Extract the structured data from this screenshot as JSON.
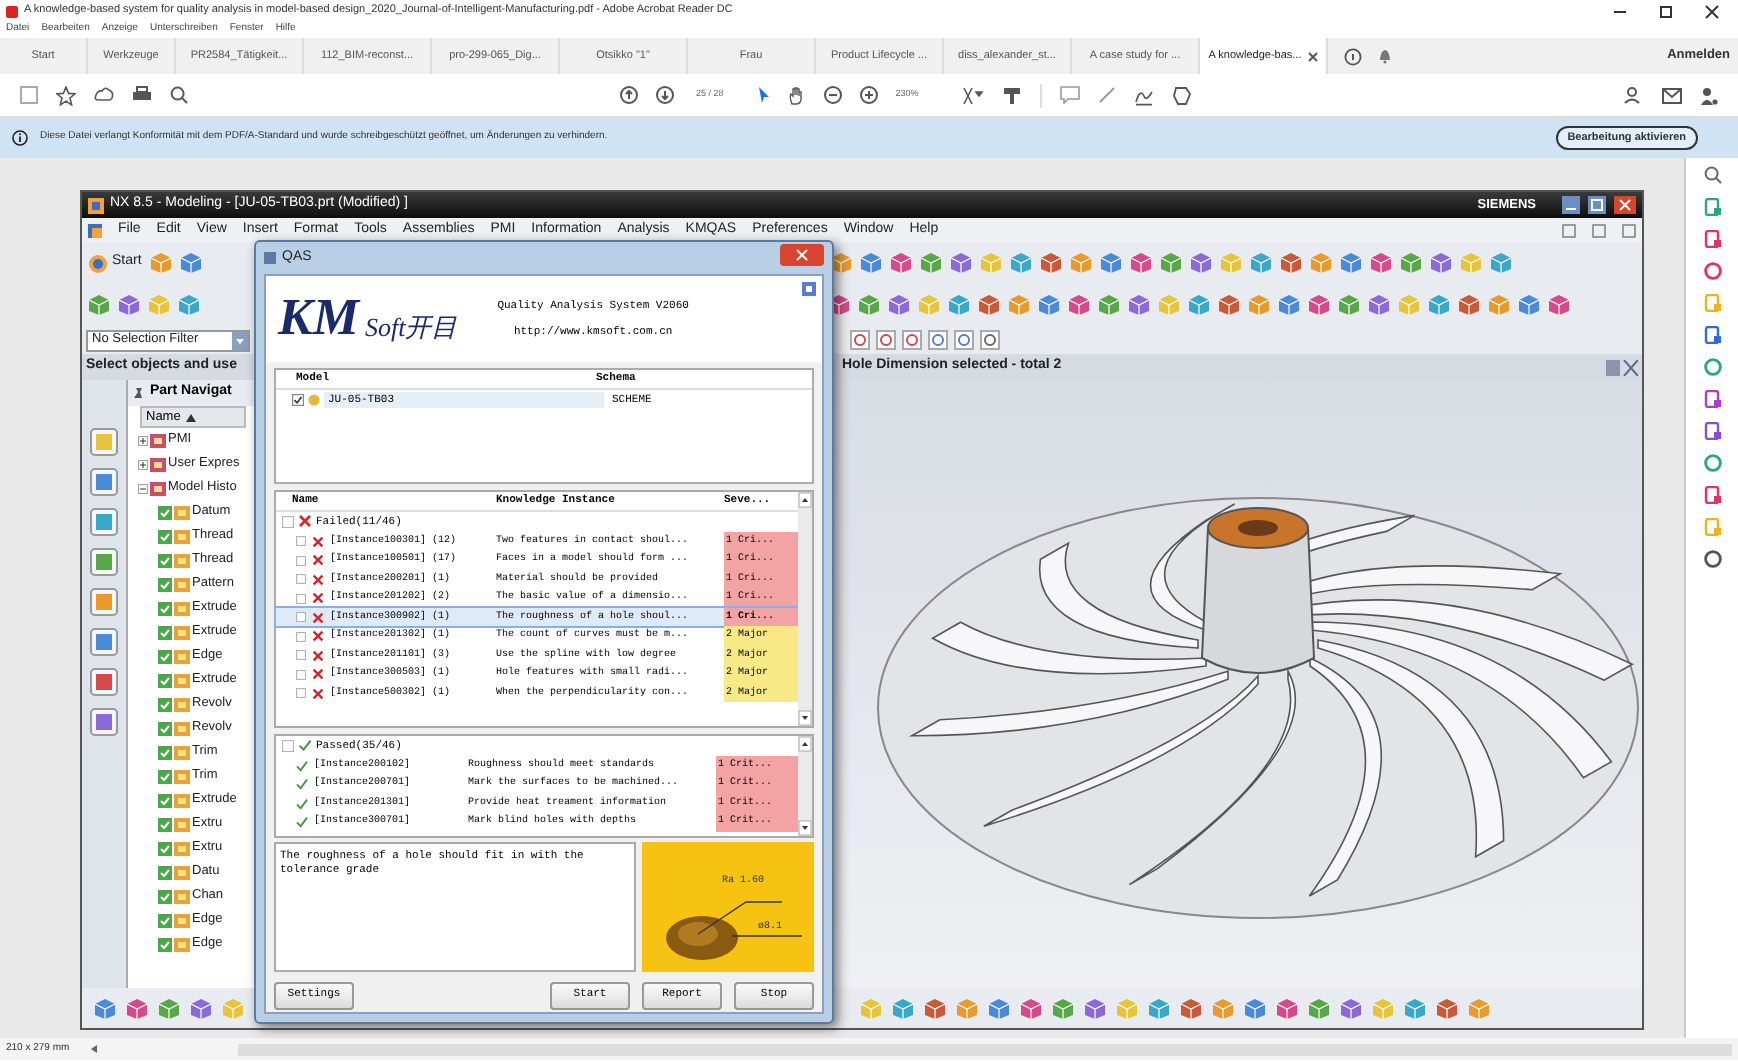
{
  "window": {
    "title": "A knowledge-based system for quality analysis in model-based design_2020_Journal-of-Intelligent-Manufacturing.pdf - Adobe Acrobat Reader DC",
    "menu": [
      "Datei",
      "Bearbeiten",
      "Anzeige",
      "Unterschreiben",
      "Fenster",
      "Hilfe"
    ]
  },
  "tabs": [
    {
      "label": "Start",
      "selected": false
    },
    {
      "label": "Werkzeuge",
      "selected": false
    },
    {
      "label": "PR2584_Tätigkeit...",
      "selected": false
    },
    {
      "label": "112_BIM-reconst...",
      "selected": false
    },
    {
      "label": "pro-299-065_Dig...",
      "selected": false
    },
    {
      "label": "Otsikko \"1\"",
      "selected": false
    },
    {
      "label": "Frau",
      "selected": false
    },
    {
      "label": "Product Lifecycle ...",
      "selected": false
    },
    {
      "label": "diss_alexander_st...",
      "selected": false
    },
    {
      "label": "A case study for ...",
      "selected": false
    },
    {
      "label": "A knowledge-bas...",
      "selected": true
    }
  ],
  "account": "Anmelden",
  "toolbar": {
    "page": "25 / 28",
    "zoom": "230%"
  },
  "notice": {
    "text": "Diese Datei verlangt Konformität mit dem PDF/A-Standard und wurde schreibgeschützt geöffnet, um Änderungen zu verhindern.",
    "button": "Bearbeitung aktivieren"
  },
  "nx": {
    "title": "NX 8.5 - Modeling - [JU-05-TB03.prt (Modified) ]",
    "brand": "SIEMENS",
    "menu": [
      "File",
      "Edit",
      "View",
      "Insert",
      "Format",
      "Tools",
      "Assemblies",
      "PMI",
      "Information",
      "Analysis",
      "KMQAS",
      "Preferences",
      "Window",
      "Help"
    ],
    "start": "Start",
    "filter": "No Selection Filter",
    "prompt": "Select objects and use",
    "status": "Hole Dimension selected - total 2",
    "navigator": {
      "title": "Part Navigat",
      "column": "Name",
      "items": [
        {
          "label": "PMI"
        },
        {
          "label": "User Expres"
        },
        {
          "label": "Model Histo",
          "children": [
            {
              "label": "Datum"
            },
            {
              "label": "Thread"
            },
            {
              "label": "Thread"
            },
            {
              "label": "Pattern"
            },
            {
              "label": "Extrude"
            },
            {
              "label": "Extrude"
            },
            {
              "label": "Edge"
            },
            {
              "label": "Extrude"
            },
            {
              "label": "Revolv"
            },
            {
              "label": "Revolv"
            },
            {
              "label": "Trim"
            },
            {
              "label": "Trim"
            },
            {
              "label": "Extrude"
            },
            {
              "label": "Extru"
            },
            {
              "label": "Extru"
            },
            {
              "label": "Datu"
            },
            {
              "label": "Chan"
            },
            {
              "label": "Edge"
            },
            {
              "label": "Edge"
            }
          ]
        }
      ]
    }
  },
  "qas": {
    "title": "QAS",
    "logo": "KM",
    "logo_text": "Soft开目",
    "system": "Quality Analysis System V2060",
    "url": "http://www.kmsoft.com.cn",
    "models": {
      "columns": [
        "Model",
        "Schema"
      ],
      "rows": [
        {
          "name": "JU-05-TB03",
          "schema": "SCHEME",
          "checked": true
        }
      ]
    },
    "knowledge": {
      "columns": [
        "Name",
        "Knowledge Instance",
        "Seve..."
      ],
      "groups": [
        {
          "kind": "failed",
          "label": "Failed(11/46)",
          "items": [
            {
              "name": "[Instance100301] (12)",
              "text": "Two features in contact shoul...",
              "severity": "1 Cri...",
              "color": "#f4a3a3",
              "selected": false
            },
            {
              "name": "[Instance100501] (17)",
              "text": "Faces in a model should form ...",
              "severity": "1 Cri...",
              "color": "#f4a3a3",
              "selected": false
            },
            {
              "name": "[Instance200201] (1)",
              "text": "Material should be provided",
              "severity": "1 Cri...",
              "color": "#f4a3a3",
              "selected": false
            },
            {
              "name": "[Instance201202] (2)",
              "text": "The basic value of a dimensio...",
              "severity": "1 Cri...",
              "color": "#f4a3a3",
              "selected": false
            },
            {
              "name": "[Instance300902] (1)",
              "text": "The roughness of a hole shoul...",
              "severity": "1 Cri...",
              "color": "#f4a3a3",
              "selected": true
            },
            {
              "name": "[Instance201302] (1)",
              "text": "The count of curves must be m...",
              "severity": "2 Major",
              "color": "#f7ea86",
              "selected": false
            },
            {
              "name": "[Instance201101] (3)",
              "text": "Use the spline with low degree",
              "severity": "2 Major",
              "color": "#f7ea86",
              "selected": false
            },
            {
              "name": "[Instance300503] (1)",
              "text": "Hole features with small radi...",
              "severity": "2 Major",
              "color": "#f7ea86",
              "selected": false
            },
            {
              "name": "[Instance500302] (1)",
              "text": "When the perpendicularity con...",
              "severity": "2 Major",
              "color": "#f7ea86",
              "selected": false
            }
          ]
        },
        {
          "kind": "passed",
          "label": "Passed(35/46)",
          "items": [
            {
              "name": "[Instance200102]",
              "text": "Roughness should meet standards",
              "severity": "1 Crit...",
              "color": "#f4a3a3",
              "selected": false
            },
            {
              "name": "[Instance200701]",
              "text": "Mark the surfaces to be machined...",
              "severity": "1 Crit...",
              "color": "#f4a3a3",
              "selected": false
            },
            {
              "name": "[Instance201301]",
              "text": "Provide heat treament information",
              "severity": "1 Crit...",
              "color": "#f4a3a3",
              "selected": false
            },
            {
              "name": "[Instance300701]",
              "text": "Mark blind holes with depths",
              "severity": "1 Crit...",
              "color": "#f4a3a3",
              "selected": false
            }
          ]
        }
      ]
    },
    "description": "The roughness of a hole should fit in with the tolerance grade",
    "diagram_labels": [
      "Ra 1.60",
      "ø8.1"
    ],
    "buttons": [
      {
        "label": "Settings",
        "kind": "left"
      },
      {
        "label": "Start",
        "kind": "right"
      },
      {
        "label": "Report",
        "kind": "right"
      },
      {
        "label": "Stop",
        "kind": "right"
      }
    ]
  },
  "status_bar": "210 x 279 mm"
}
